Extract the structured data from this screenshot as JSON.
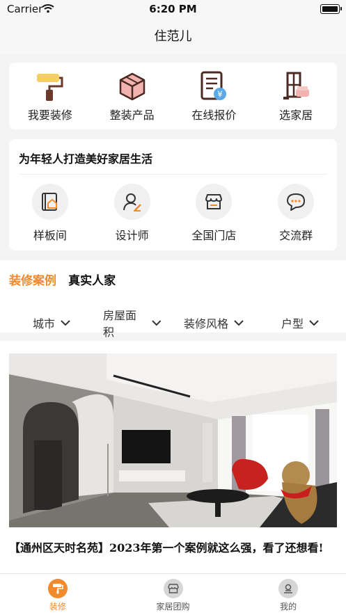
{
  "status_bar": {
    "carrier": "Carrier",
    "time": "6:20 PM"
  },
  "header": {
    "title": "住范儿"
  },
  "quick_menu": [
    {
      "label": "我要装修",
      "icon": "paint-roller-icon"
    },
    {
      "label": "整装产品",
      "icon": "box-icon"
    },
    {
      "label": "在线报价",
      "icon": "quote-document-icon"
    },
    {
      "label": "选家居",
      "icon": "furniture-icon"
    }
  ],
  "promo": {
    "slogan": "为年轻人打造美好家居生活",
    "items": [
      {
        "label": "样板间",
        "icon": "house-document-icon"
      },
      {
        "label": "设计师",
        "icon": "designer-icon"
      },
      {
        "label": "全国门店",
        "icon": "store-icon"
      },
      {
        "label": "交流群",
        "icon": "chat-bubble-icon"
      }
    ]
  },
  "cases": {
    "tabs": [
      {
        "label": "装修案例",
        "active": true
      },
      {
        "label": "真实人家",
        "active": false
      }
    ],
    "filters": [
      {
        "label": "城市"
      },
      {
        "label": "房屋面积"
      },
      {
        "label": "装修风格"
      },
      {
        "label": "户型"
      }
    ]
  },
  "feed": {
    "items": [
      {
        "caption": "【通州区天时名苑】2023年第一个案例就这么强，看了还想看!"
      }
    ]
  },
  "tab_bar": [
    {
      "label": "装修",
      "icon": "paint-roller-icon",
      "active": true
    },
    {
      "label": "家居团购",
      "icon": "store-icon",
      "active": false
    },
    {
      "label": "我的",
      "icon": "profile-icon",
      "active": false
    }
  ],
  "colors": {
    "accent": "#f08a2c",
    "background": "#f4f4f4",
    "card": "#ffffff"
  }
}
